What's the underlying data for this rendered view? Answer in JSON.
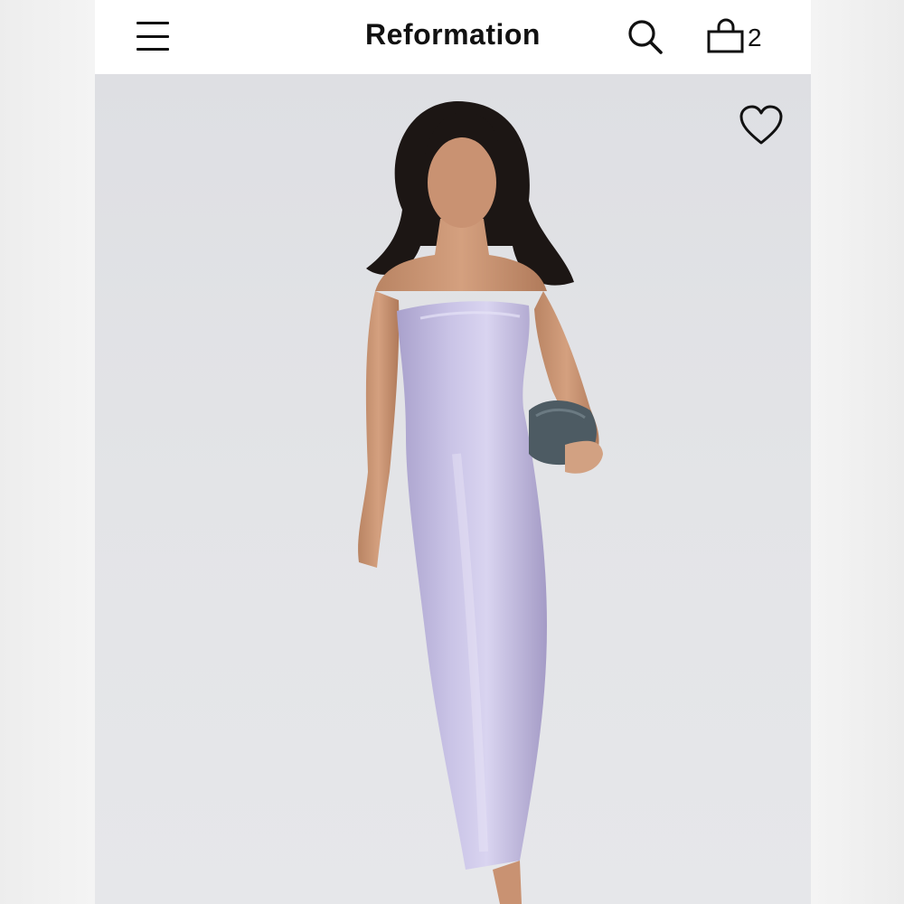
{
  "header": {
    "brand": "Reformation",
    "menu_icon": "hamburger-menu-icon",
    "search_icon": "search-icon",
    "bag_icon": "shopping-bag-icon",
    "bag_count": "2"
  },
  "product": {
    "wishlist_icon": "heart-icon",
    "image_background": "#e0e1e4",
    "dress_color": "#b9b2d8"
  }
}
